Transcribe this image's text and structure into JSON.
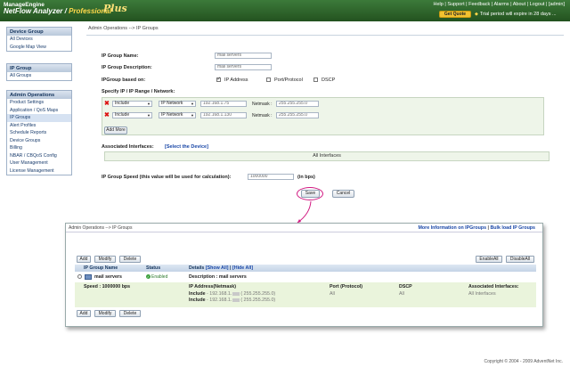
{
  "header": {
    "brand_top": "ManageEngine",
    "brand_product": "NetFlow Analyzer",
    "brand_edition": "Professional",
    "brand_plus": "Plus",
    "links": [
      "Help",
      "Support",
      "Feedback",
      "Alarms",
      "About",
      "Logout"
    ],
    "user": "[admin]",
    "get_quote": "Get Quote",
    "trial_text": "Trial period will expire in 28 days ..."
  },
  "sidebar": {
    "device_group": {
      "title": "Device Group",
      "items": [
        "All Devices",
        "Google Map View"
      ]
    },
    "ip_group": {
      "title": "IP Group",
      "items": [
        "All Groups"
      ]
    },
    "admin_ops": {
      "title": "Admin Operations",
      "items": [
        "Product Settings",
        "Application / QoS Maps",
        "IP Groups",
        "Alert Profiles",
        "Schedule Reports",
        "Device Groups",
        "Billing",
        "NBAR / CBQoS Config",
        "User Management",
        "License Management"
      ]
    }
  },
  "form": {
    "breadcrumb": "Admin Operations --> IP Groups",
    "name_label": "IP Group Name:",
    "name_value": "mail servers",
    "desc_label": "IP Group Description:",
    "desc_value": "mail servers",
    "based_label": "IPGroup based on:",
    "opt_ip": "IP Address",
    "opt_port": "Port/Protocol",
    "opt_dscp": "DSCP",
    "specify_label": "Specify IP / IP Range / Network:",
    "rows": [
      {
        "mode": "Include",
        "type": "IP Network",
        "ip": "192.168.1.75",
        "netmask_label": "Netmask :",
        "netmask": "255.255.255.0"
      },
      {
        "mode": "Include",
        "type": "IP Network",
        "ip": "192.168.1.130",
        "netmask_label": "Netmask :",
        "netmask": "255.255.255.0"
      }
    ],
    "add_more": "Add More",
    "assoc_label": "Associated Interfaces:",
    "assoc_link": "[Select the Device]",
    "all_interfaces": "All Interfaces",
    "speed_label": "IP Group Speed (this value will be used for calculation):",
    "speed_value": "1000000",
    "speed_unit": "(in bps)",
    "save": "Save",
    "cancel": "Cancel"
  },
  "popup": {
    "breadcrumb": "Admin Operations --> IP Groups",
    "more_info": "More Information on IPGroups",
    "separator": "|",
    "bulk_load": "Bulk load IP Groups",
    "btn_add": "Add",
    "btn_modify": "Modify",
    "btn_delete": "Delete",
    "btn_enable_all": "EnableAll",
    "btn_disable_all": "DisableAll",
    "col_name": "IP Group Name",
    "col_status": "Status",
    "col_details": "Details",
    "show_all": "[Show All]",
    "hide_all": "[Hide All]",
    "group_name": "mail servers",
    "status": "Enabled",
    "desc_label": "Description :",
    "desc_value": "mail servers",
    "speed_label": "Speed : 1000000 bps",
    "ipcol": "IP Address(Netmask)",
    "portcol": "Port (Protocol)",
    "dscpcol": "DSCP",
    "assoccol": "Associated Interfaces:",
    "inc1_prefix": "Include",
    "inc1_ip": "- 192.168.1.",
    "inc1_mask": "( 255.255.255.0)",
    "inc2_prefix": "Include",
    "inc2_ip": "- 192.168.1.",
    "inc2_mask": "( 255.255.255.0)",
    "port_val": "All",
    "dscp_val": "All",
    "assoc_val": "All Interfaces"
  },
  "footer": "Copyright © 2004 - 2009 AdventNet Inc."
}
